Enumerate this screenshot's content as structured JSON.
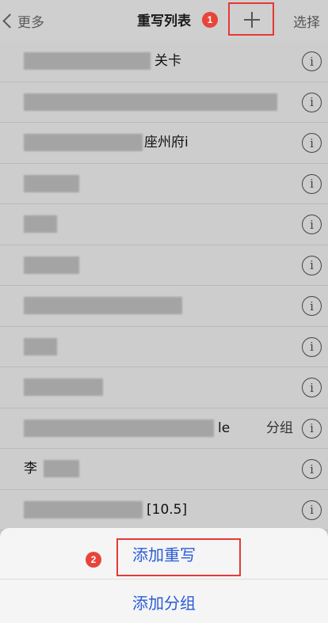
{
  "navbar": {
    "back_label": "更多",
    "title": "重写列表",
    "step1": "1",
    "add_icon": "plus-icon",
    "select_label": "选择"
  },
  "list": {
    "rows": [
      {
        "label": "关卡",
        "meta": ""
      },
      {
        "label": "",
        "meta": ""
      },
      {
        "label": "座州府i",
        "meta": ""
      },
      {
        "label": "",
        "meta": ""
      },
      {
        "label": "",
        "meta": ""
      },
      {
        "label": "",
        "meta": ""
      },
      {
        "label": "",
        "meta": ""
      },
      {
        "label": "",
        "meta": ""
      },
      {
        "label": "",
        "meta": ""
      },
      {
        "label": "le",
        "meta": "分组"
      },
      {
        "label": "李",
        "meta": ""
      },
      {
        "label": "[10.5]",
        "meta": ""
      }
    ]
  },
  "sheet": {
    "add_rewrite_label": "添加重写",
    "add_group_label": "添加分组",
    "step2": "2"
  },
  "colors": {
    "highlight": "#e53935",
    "badge": "#e8443a",
    "link": "#2a5bd7"
  }
}
